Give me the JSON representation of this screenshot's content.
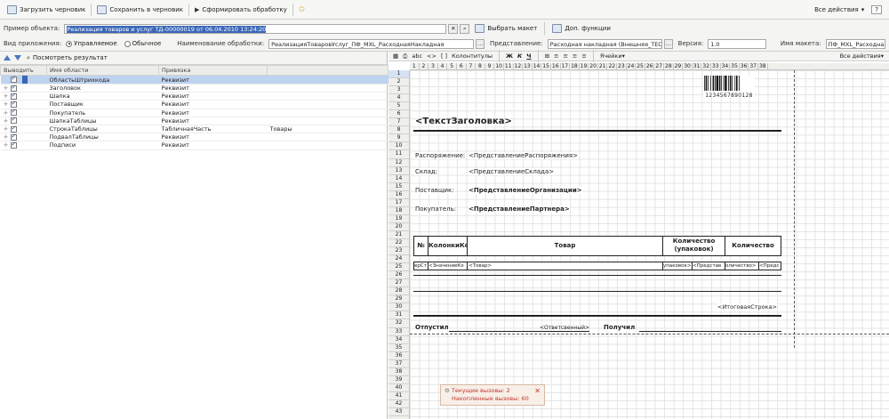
{
  "toolbar": {
    "load_draft": "Загрузить черновик",
    "save_draft": "Сохранить в черновик",
    "generate": "Сформировать обработку",
    "all_actions": "Все действия",
    "help": "?"
  },
  "form": {
    "example_label": "Пример объекта:",
    "example_value": "Реализация товаров и услуг ТД-00000019 от 06.04.2010 13:24:20",
    "choose_layout": "Выбрать макет",
    "extra_functions": "Доп. функции",
    "app_type_label": "Вид приложения:",
    "app_type_managed": "Управляемое",
    "app_type_regular": "Обычное",
    "processing_name_label": "Наименование обработки:",
    "processing_name_value": "РеализацияТоваровУслуг_ПФ_MXL_РасходнаяНакладная",
    "representation_label": "Представление:",
    "representation_value": "Расходная накладная (Внешняя_ТЕСТ_ТЕСТ)",
    "version_label": "Версия:",
    "version_value": "1.0",
    "layout_name_label": "Имя макета:",
    "layout_name_value": "ПФ_MXL_РасходнаяН"
  },
  "left_panel": {
    "view_result": "Посмотреть результат",
    "columns": [
      "Выводить",
      "Имя области",
      "Привязка"
    ],
    "rows": [
      {
        "name": "ОбластьШтрихкода",
        "binding": "Реквизит",
        "extra": ""
      },
      {
        "name": "Заголовок",
        "binding": "Реквизит",
        "extra": ""
      },
      {
        "name": "Шапка",
        "binding": "Реквизит",
        "extra": ""
      },
      {
        "name": "Поставщик",
        "binding": "Реквизит",
        "extra": ""
      },
      {
        "name": "Покупатель",
        "binding": "Реквизит",
        "extra": ""
      },
      {
        "name": "ШапкаТаблицы",
        "binding": "Реквизит",
        "extra": ""
      },
      {
        "name": "СтрокаТаблицы",
        "binding": "ТабличнаяЧасть",
        "extra": "Товары"
      },
      {
        "name": "ПодвалТаблицы",
        "binding": "Реквизит",
        "extra": ""
      },
      {
        "name": "Подписи",
        "binding": "Реквизит",
        "extra": ""
      }
    ]
  },
  "right_panel": {
    "toolbar": {
      "abc": "аbc",
      "headers_footers": "Колонтитулы",
      "cells": "Ячейки",
      "all_actions": "Все действия"
    },
    "column_numbers": [
      "1",
      "2",
      "3",
      "4",
      "5",
      "6",
      "7",
      "8",
      "9",
      "10",
      "11",
      "12",
      "13",
      "14",
      "15",
      "16",
      "17",
      "18",
      "19",
      "20",
      "21",
      "22",
      "23",
      "24",
      "25",
      "26",
      "27",
      "28",
      "29",
      "30",
      "31",
      "32",
      "33",
      "34",
      "35",
      "36",
      "37",
      "38"
    ],
    "row_numbers": [
      "1",
      "2",
      "3",
      "4",
      "5",
      "6",
      "7",
      "8",
      "9",
      "10",
      "11",
      "12",
      "13",
      "14",
      "15",
      "16",
      "17",
      "18",
      "19",
      "20",
      "21",
      "22",
      "23",
      "24",
      "25",
      "26",
      "27",
      "28",
      "29",
      "30",
      "31",
      "32",
      "33",
      "34",
      "35",
      "36",
      "37",
      "38",
      "39",
      "40",
      "41",
      "42",
      "43"
    ],
    "barcode_number": "1234567890128",
    "title_text": "<ТекстЗаголовка>",
    "order_label": "Распоряжение:",
    "order_value": "<ПредставлениеРаспоряжения>",
    "warehouse_label": "Склад:",
    "warehouse_value": "<ПредставлениеСклада>",
    "supplier_label": "Поставщик:",
    "supplier_value": "<ПредставлениеОрганизации>",
    "buyer_label": "Покупатель:",
    "buyer_value": "<ПредставлениеПартнера>",
    "table_header": [
      "№",
      "КолонкиКс",
      "Товар",
      "Количество (упаковок)",
      "Количество"
    ],
    "table_row": [
      "ерСт",
      "<ЗначениеКо",
      "<Товар>",
      "упаковок>",
      "<Представ",
      "оличество>",
      "<Предс"
    ],
    "total_line": "<ИтоговаяСтрока>",
    "shipped": "Отпустил",
    "responsible": "<Ответсвенный>",
    "received": "Получил"
  },
  "notice": {
    "current_calls": "Текущие вызовы: 2",
    "accumulated_calls": "Накопленные вызовы: 60"
  }
}
